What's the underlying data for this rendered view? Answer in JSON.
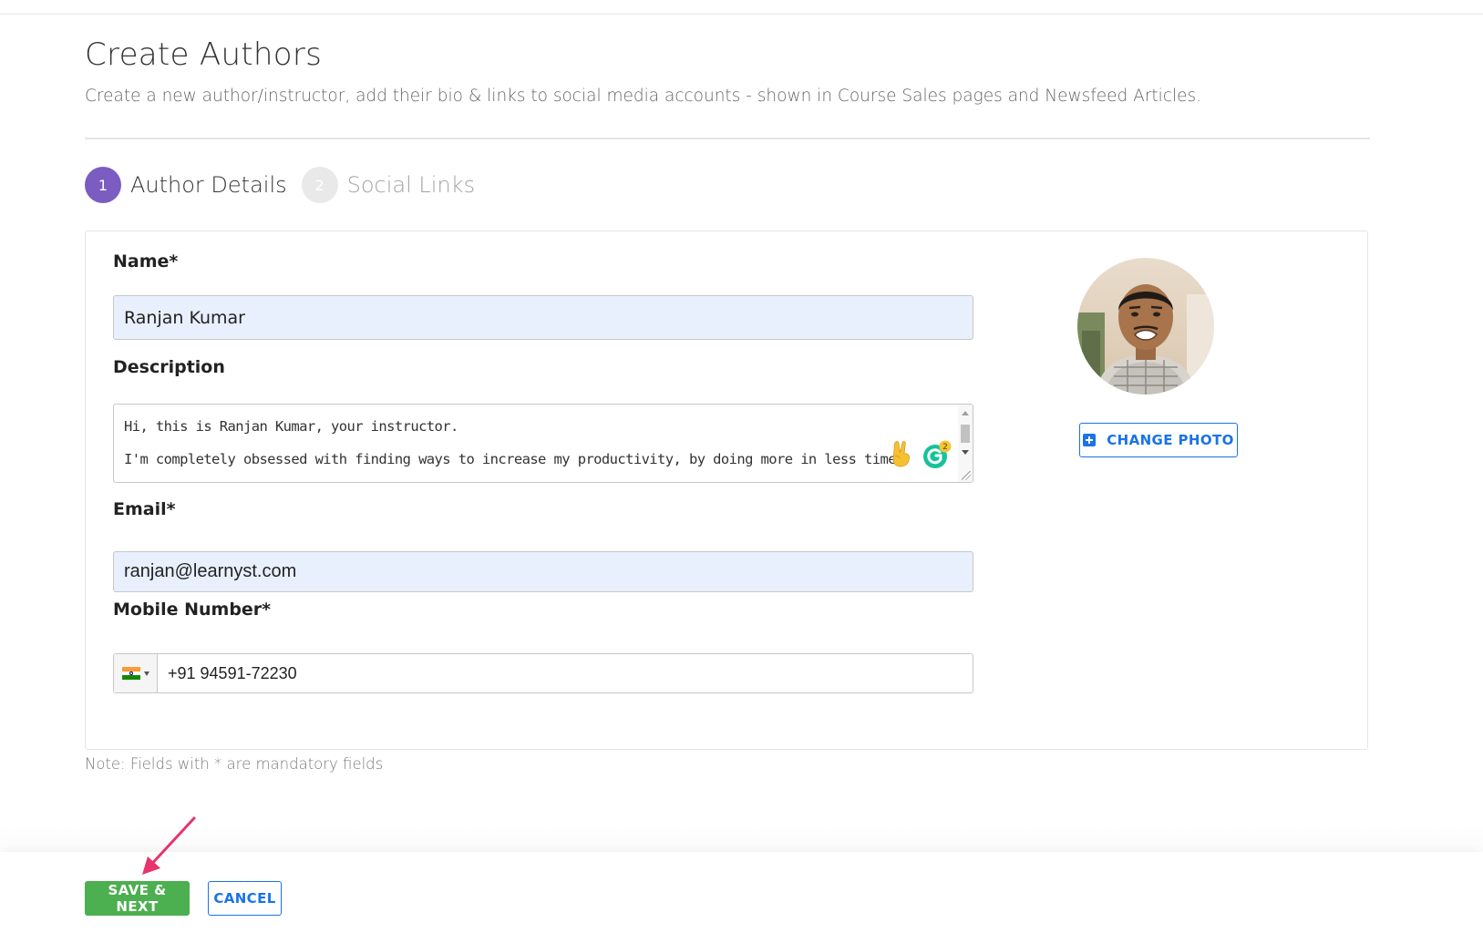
{
  "header": {
    "title": "Create Authors",
    "subtitle": "Create a new author/instructor, add their bio & links to social media accounts - shown in Course Sales pages and Newsfeed Articles."
  },
  "stepper": {
    "steps": [
      {
        "number": "1",
        "label": "Author Details",
        "active": true
      },
      {
        "number": "2",
        "label": "Social Links",
        "active": false
      }
    ]
  },
  "form": {
    "name": {
      "label": "Name*",
      "value": "Ranjan Kumar"
    },
    "description": {
      "label": "Description",
      "lines": [
        "Hi, this is Ranjan Kumar, your instructor.",
        "I'm completely obsessed with finding ways to increase my productivity, by doing more in less time!"
      ],
      "grammarly_count": "2"
    },
    "email": {
      "label": "Email*",
      "value": "ranjan@learnyst.com"
    },
    "mobile": {
      "label": "Mobile Number*",
      "country": "India",
      "value": "+91 94591-72230"
    },
    "change_photo_label": "CHANGE PHOTO"
  },
  "note": "Note: Fields with * are mandatory fields",
  "footer": {
    "save_label": "SAVE & NEXT",
    "cancel_label": "CANCEL"
  },
  "colors": {
    "accent_purple": "#7b5cc1",
    "primary_blue": "#1a73e8",
    "save_green": "#4caf50",
    "autofill_bg": "#e8f0fe",
    "arrow_pink": "#e8336d"
  }
}
